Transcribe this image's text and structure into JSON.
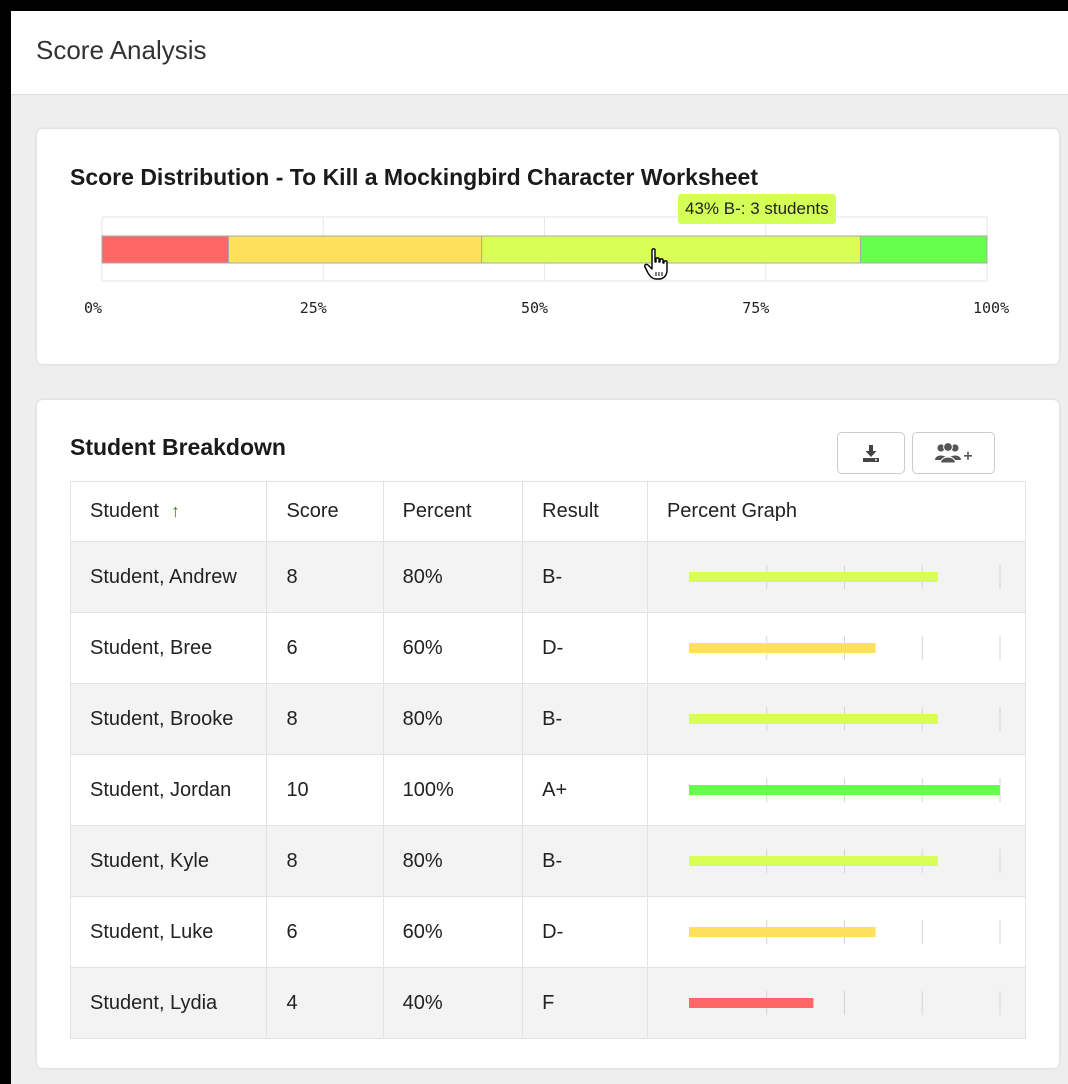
{
  "header": {
    "title": "Score Analysis"
  },
  "distribution": {
    "title": "Score Distribution - To Kill a Mockingbird Character Worksheet",
    "tooltip": "43% B-: 3 students",
    "tick_labels": [
      "0%",
      "25%",
      "50%",
      "75%",
      "100%"
    ],
    "segments": [
      {
        "from": 0,
        "to": 14.3,
        "color": "#ff6666"
      },
      {
        "from": 14.3,
        "to": 42.9,
        "color": "#ffe05c"
      },
      {
        "from": 42.9,
        "to": 85.7,
        "color": "#d9ff57"
      },
      {
        "from": 85.7,
        "to": 100,
        "color": "#66ff4d"
      }
    ]
  },
  "breakdown": {
    "title": "Student Breakdown",
    "download_icon": "download-icon",
    "group_icon": "add-group-icon",
    "columns": [
      "Student",
      "Score",
      "Percent",
      "Result",
      "Percent Graph"
    ],
    "sort_indicator": "↑",
    "rows": [
      {
        "student": "Student, Andrew",
        "score": "8",
        "percent": "80%",
        "result": "B-",
        "value": 80,
        "color": "#d9ff57"
      },
      {
        "student": "Student, Bree",
        "score": "6",
        "percent": "60%",
        "result": "D-",
        "value": 60,
        "color": "#ffe05c"
      },
      {
        "student": "Student, Brooke",
        "score": "8",
        "percent": "80%",
        "result": "B-",
        "value": 80,
        "color": "#d9ff57"
      },
      {
        "student": "Student, Jordan",
        "score": "10",
        "percent": "100%",
        "result": "A+",
        "value": 100,
        "color": "#66ff4d"
      },
      {
        "student": "Student, Kyle",
        "score": "8",
        "percent": "80%",
        "result": "B-",
        "value": 80,
        "color": "#d9ff57"
      },
      {
        "student": "Student, Luke",
        "score": "6",
        "percent": "60%",
        "result": "D-",
        "value": 60,
        "color": "#ffe05c"
      },
      {
        "student": "Student, Lydia",
        "score": "4",
        "percent": "40%",
        "result": "F",
        "value": 40,
        "color": "#ff6666"
      }
    ]
  }
}
